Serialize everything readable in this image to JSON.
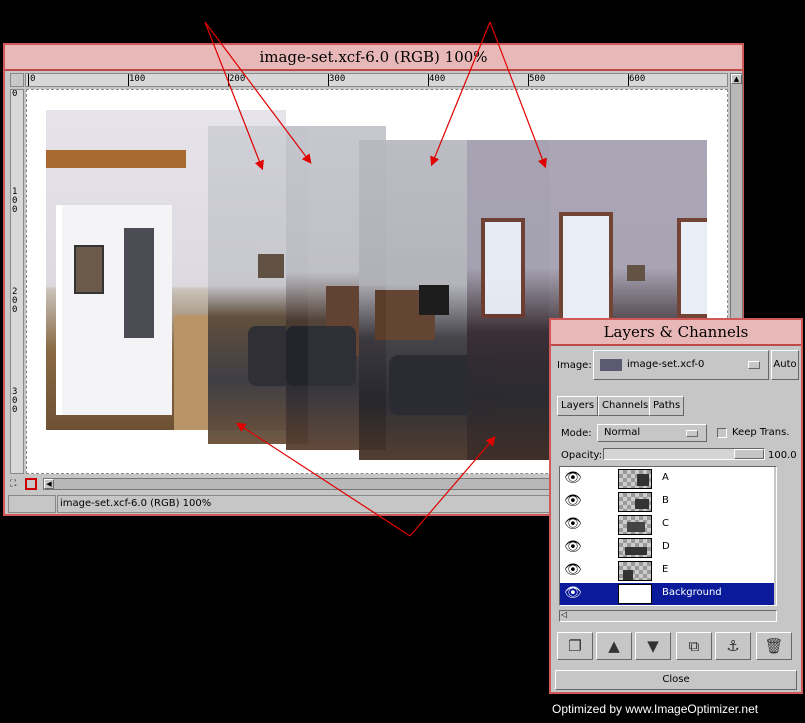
{
  "image_window": {
    "title": "image-set.xcf-6.0 (RGB) 100%",
    "status": "image-set.xcf-6.0 (RGB) 100%",
    "hruler_labels": [
      "0",
      "100",
      "200",
      "300",
      "400",
      "500",
      "600"
    ],
    "vruler_labels": [
      "0",
      "100",
      "200",
      "300"
    ]
  },
  "layers_dialog": {
    "title": "Layers & Channels",
    "image_label": "Image:",
    "image_value": "image-set.xcf-0",
    "auto_button": "Auto",
    "tabs": [
      "Layers",
      "Channels",
      "Paths"
    ],
    "mode_label": "Mode:",
    "mode_value": "Normal",
    "keep_trans_label": "Keep Trans.",
    "opacity_label": "Opacity:",
    "opacity_value": "100.0",
    "layers": [
      "A",
      "B",
      "C",
      "D",
      "E",
      "Background"
    ],
    "selected_layer": "Background",
    "close_button": "Close"
  },
  "watermark": "Optimized by www.ImageOptimizer.net",
  "colors": {
    "title_bar": "#e8b8b8",
    "window_border": "#d05858",
    "selection": "#0a1a9a",
    "arrow": "#e00000"
  },
  "icons": [
    "eye-icon",
    "new-layer-icon",
    "raise-layer-icon",
    "lower-layer-icon",
    "duplicate-layer-icon",
    "anchor-icon",
    "trash-icon"
  ]
}
